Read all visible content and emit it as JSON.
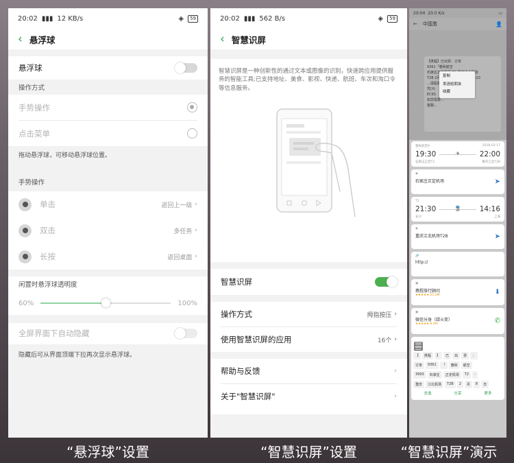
{
  "colors": {
    "accent": "#4caf50",
    "back_arrow": "#2e9d4c",
    "background": "#f2f2f2"
  },
  "panel1": {
    "status": {
      "time": "20:02",
      "net": "12 KB/s",
      "battery": "59"
    },
    "title": "悬浮球",
    "master": {
      "label": "悬浮球",
      "enabled": false
    },
    "mode_section": "操作方式",
    "mode_gesture": "手势操作",
    "mode_menu": "点击菜单",
    "note1": "拖动悬浮球，可移动悬浮球位置。",
    "gesture_section": "手势操作",
    "gestures": [
      {
        "label": "单击",
        "value": "返回上一级"
      },
      {
        "label": "双击",
        "value": "多任务"
      },
      {
        "label": "长按",
        "value": "返回桌面"
      }
    ],
    "opacity_section": "闲置时悬浮球透明度",
    "opacity_min": "60%",
    "opacity_max": "100%",
    "opacity_fraction": 0.5,
    "fullscreen": {
      "label": "全屏界面下自动隐藏",
      "enabled": false
    },
    "note2": "隐藏后可从界面顶端下拉再次显示悬浮球。"
  },
  "panel2": {
    "status": {
      "time": "20:02",
      "net": "562 B/s",
      "battery": "59"
    },
    "title": "智慧识屏",
    "description": "智慧识屏是一种创新性的通过文本或图像的识别，快速跨应用提供服务的智能工具;已支持地址、美食、影视、快递、航班、车次和淘口令等信息服务。",
    "toggle": {
      "label": "智慧识屏",
      "enabled": true
    },
    "method": {
      "label": "操作方式",
      "value": "拇指按压"
    },
    "apps": {
      "label": "使用智慧识屏的应用",
      "value": "16个"
    },
    "help": "帮助与反馈",
    "about": "关于\"智慧识屏\""
  },
  "panel3": {
    "status_time": "20:04",
    "status_net": "20.0 K/s",
    "chat_title": "中国激",
    "message": [
      "【携程】已出票：订单",
      "9361「春秋航空",
      "石家庄正定机场 T2-重庆江北机场",
      "T2B 2月8日 18:30-2月8日 21:10",
      "...请提前2小时到达机场...",
      "凭(X)",
      "ECKS",
      "如您需要...",
      "客服..."
    ],
    "menu": [
      "复制",
      "发送给朋友",
      "收藏"
    ],
    "flight": {
      "tag": "春秋航空9",
      "date": "2018-02-17",
      "dep_time": "19:30",
      "arr_time": "22:00",
      "dep_place": "石家庄正定T2",
      "arr_place": "重庆江北T2B"
    },
    "dep_airport": "石家庄正定机场",
    "train": {
      "tag": "T2",
      "dep_time": "21:30",
      "arr_time": "14:16",
      "dep_place": "长沙",
      "arr_place": "上海"
    },
    "arr_airport": "重庆江北机场T2B",
    "link": "http://",
    "app1": {
      "name": "携程旅行顾问",
      "rating": "★★★★★ 21.2M"
    },
    "app2": {
      "name": "微信分身（绿斗变）",
      "rating": "★★★★★ 8.4M"
    },
    "keys_row1": [
      "【",
      "携程",
      "】",
      "已",
      "出",
      "票",
      "："
    ],
    "keys_row2": [
      "订单",
      "9361",
      "「",
      "春秋",
      "航空"
    ],
    "keys_row3": [
      "3993",
      "石家庄",
      "正定机场",
      "T2",
      "-"
    ],
    "keys_row4": [
      "重庆",
      "江北机场",
      "T2B",
      "2",
      "月",
      "8",
      "日"
    ],
    "bottom": [
      "全选",
      "分享",
      "更多"
    ]
  },
  "captions": [
    "“悬浮球”设置",
    "“智慧识屏”设置",
    "“智慧识屏”演示"
  ]
}
